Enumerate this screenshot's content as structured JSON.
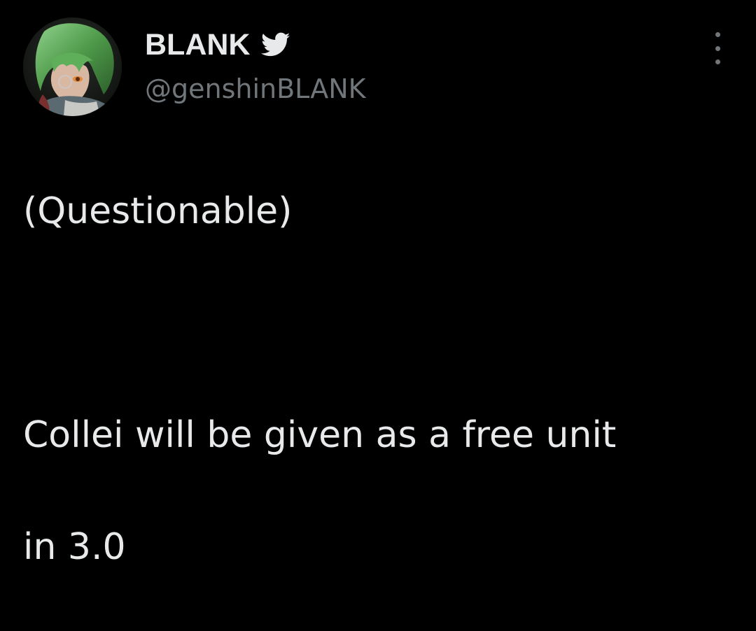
{
  "user": {
    "display_name": "BLANK",
    "handle": "@genshinBLANK",
    "avatar_icon": "anime-avatar-green-hair",
    "verified_icon": "twitter-bird-icon"
  },
  "tweet": {
    "lines": [
      "(Questionable)",
      "",
      "Collei will be given as a free unit",
      "in 3.0"
    ]
  },
  "actions": {
    "more_icon": "more-options-icon"
  },
  "colors": {
    "background": "#000000",
    "primary_text": "#e7e9ea",
    "secondary_text": "#71767b"
  }
}
